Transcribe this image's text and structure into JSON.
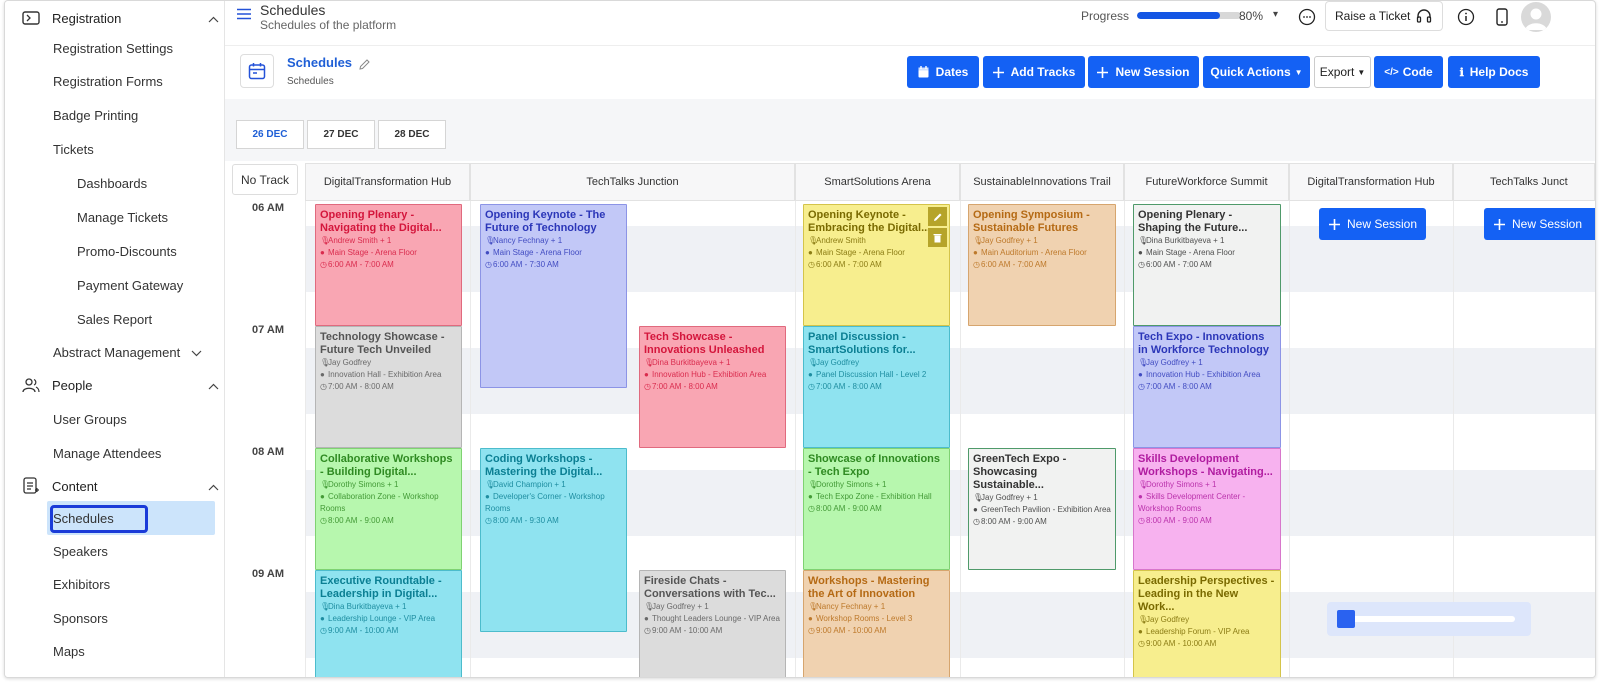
{
  "sidebar": {
    "registration": "Registration",
    "registration_settings": "Registration Settings",
    "registration_forms": "Registration Forms",
    "badge_printing": "Badge Printing",
    "tickets": "Tickets",
    "dashboards": "Dashboards",
    "manage_tickets": "Manage Tickets",
    "promo_discounts": "Promo-Discounts",
    "payment_gateway": "Payment Gateway",
    "sales_report": "Sales Report",
    "abstract_management": "Abstract Management",
    "people": "People",
    "user_groups": "User Groups",
    "manage_attendees": "Manage Attendees",
    "content": "Content",
    "schedules": "Schedules",
    "speakers": "Speakers",
    "exhibitors": "Exhibitors",
    "sponsors": "Sponsors",
    "maps": "Maps"
  },
  "header": {
    "title": "Schedules",
    "subtitle": "Schedules of the platform",
    "progress_label": "Progress",
    "progress_value": "80%",
    "progress_fraction": 0.8,
    "raise_ticket": "Raise a Ticket"
  },
  "page": {
    "title": "Schedules",
    "breadcrumb": "Schedules",
    "buttons": {
      "dates": "Dates",
      "add_tracks": "Add Tracks",
      "new_session": "New Session",
      "quick_actions": "Quick Actions",
      "export": "Export",
      "code": "Code",
      "help_docs": "Help Docs"
    }
  },
  "days": [
    "26 DEC",
    "27 DEC",
    "28 DEC"
  ],
  "no_track": "No Track",
  "tracks": [
    "DigitalTransformation Hub",
    "TechTalks Junction",
    "SmartSolutions Arena",
    "SustainableInnovations Trail",
    "FutureWorkforce Summit",
    "DigitalTransformation Hub",
    "TechTalks Junct"
  ],
  "hours": [
    "06 AM",
    "07 AM",
    "08 AM",
    "09 AM"
  ],
  "new_session_label": "New Session",
  "events": [
    {
      "title": "Opening Plenary - Navigating the Digital...",
      "speaker": "Andrew Smith + 1",
      "location": "Main Stage - Arena Floor",
      "time": "6:00 AM - 7:00 AM",
      "bg": "#f9a6b3",
      "border": "#e06a7e",
      "text": "#d4163c"
    },
    {
      "title": "Opening Keynote - The Future of Technology",
      "speaker": "Nancy Fechnay + 1",
      "location": "Main Stage - Arena Floor",
      "time": "6:00 AM - 7:30 AM",
      "bg": "#c2c8f7",
      "border": "#8c94e6",
      "text": "#2b36b8"
    },
    {
      "title": "Opening Keynote - Embracing the Digital...",
      "speaker": "Andrew Smith",
      "location": "Main Stage - Arena Floor",
      "time": "6:00 AM - 7:00 AM",
      "bg": "#f7ee8e",
      "border": "#d4c44a",
      "text": "#7a6a00"
    },
    {
      "title": "Opening Symposium - Sustainable Futures",
      "speaker": "Jay Godfrey + 1",
      "location": "Main Auditorium - Arena Floor",
      "time": "6:00 AM - 7:00 AM",
      "bg": "#f0d2b0",
      "border": "#d6a56e",
      "text": "#b56a14"
    },
    {
      "title": "Opening Plenary - Shaping the Future...",
      "speaker": "Dina Burkitbayeva + 1",
      "location": "Main Stage - Arena Floor",
      "time": "6:00 AM - 7:00 AM",
      "bg": "#f1f2f1",
      "border": "#4f9a6a",
      "text": "#333333"
    },
    {
      "title": "Technology Showcase - Future Tech Unveiled",
      "speaker": "Jay Godfrey",
      "location": "Innovation Hall - Exhibition Area",
      "time": "7:00 AM - 8:00 AM",
      "bg": "#dcdcdc",
      "border": "#b5b5b5",
      "text": "#555555"
    },
    {
      "title": "Tech Showcase - Innovations Unleashed",
      "speaker": "Dina Burkitbayeva + 1",
      "location": "Innovation Hub - Exhibition Area",
      "time": "7:00 AM - 8:00 AM",
      "bg": "#f9a6b3",
      "border": "#e06a7e",
      "text": "#d4163c"
    },
    {
      "title": "Panel Discussion - SmartSolutions for...",
      "speaker": "Jay Godfrey",
      "location": "Panel Discussion Hall - Level 2",
      "time": "7:00 AM - 8:00 AM",
      "bg": "#8fe3f0",
      "border": "#4cbccc",
      "text": "#0b7f93"
    },
    {
      "title": "Tech Expo - Innovations in Workforce Technology",
      "speaker": "Jay Godfrey + 1",
      "location": "Innovation Hub - Exhibition Area",
      "time": "7:00 AM - 8:00 AM",
      "bg": "#c2c8f7",
      "border": "#8c94e6",
      "text": "#2b36b8"
    },
    {
      "title": "Collaborative Workshops - Building Digital...",
      "speaker": "Dorothy Simons + 1",
      "location": "Collaboration Zone - Workshop Rooms",
      "time": "8:00 AM - 9:00 AM",
      "bg": "#b7f7ae",
      "border": "#7fd272",
      "text": "#2f8a22"
    },
    {
      "title": "Coding Workshops - Mastering the Digital...",
      "speaker": "David Champion + 1",
      "location": "Developer's Corner - Workshop Rooms",
      "time": "8:00 AM - 9:30 AM",
      "bg": "#8fe3f0",
      "border": "#4cbccc",
      "text": "#0b7f93"
    },
    {
      "title": "Showcase of Innovations - Tech Expo",
      "speaker": "Dorothy Simons + 1",
      "location": "Tech Expo Zone - Exhibition Hall",
      "time": "8:00 AM - 9:00 AM",
      "bg": "#b7f7ae",
      "border": "#7fd272",
      "text": "#2f8a22"
    },
    {
      "title": "GreenTech Expo - Showcasing Sustainable...",
      "speaker": "Jay Godfrey + 1",
      "location": "GreenTech Pavilion - Exhibition Area",
      "time": "8:00 AM - 9:00 AM",
      "bg": "#f1f2f1",
      "border": "#4f9a6a",
      "text": "#333333"
    },
    {
      "title": "Skills Development Workshops - Navigating...",
      "speaker": "Dorothy Simons + 1",
      "location": "Skills Development Center - Workshop Rooms",
      "time": "8:00 AM - 9:00 AM",
      "bg": "#f7b2ef",
      "border": "#d776cb",
      "text": "#b01ca0"
    },
    {
      "title": "Executive Roundtable - Leadership in Digital...",
      "speaker": "Dina Burkitbayeva + 1",
      "location": "Leadership Lounge - VIP Area",
      "time": "9:00 AM - 10:00 AM",
      "bg": "#8fe3f0",
      "border": "#4cbccc",
      "text": "#0b7f93"
    },
    {
      "title": "Fireside Chats - Conversations with Tec...",
      "speaker": "Jay Godfrey + 1",
      "location": "Thought Leaders Lounge - VIP Area",
      "time": "9:00 AM - 10:00 AM",
      "bg": "#dcdcdc",
      "border": "#b5b5b5",
      "text": "#555555"
    },
    {
      "title": "Workshops - Mastering the Art of Innovation",
      "speaker": "Nancy Fechnay + 1",
      "location": "Workshop Rooms - Level 3",
      "time": "9:00 AM - 10:00 AM",
      "bg": "#f0d2b0",
      "border": "#d6a56e",
      "text": "#b56a14"
    },
    {
      "title": "Leadership Perspectives - Leading in the New Work...",
      "speaker": "Jay Godfrey",
      "location": "Leadership Forum - VIP Area",
      "time": "9:00 AM - 10:00 AM",
      "bg": "#f7ee8e",
      "border": "#d4c44a",
      "text": "#7a6a00"
    }
  ]
}
